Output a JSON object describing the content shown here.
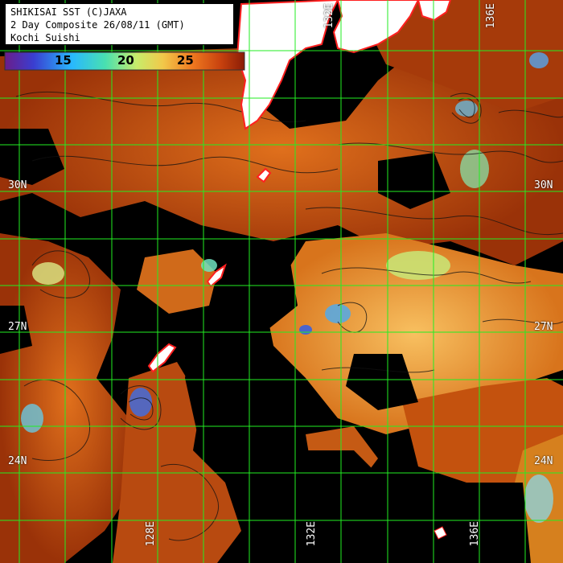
{
  "header": {
    "line1": "SHIKISAI SST (C)JAXA",
    "line2": "2 Day Composite 26/08/11 (GMT)",
    "line3": "Kochi Suishi"
  },
  "colorbar": {
    "ticks": [
      "15",
      "20",
      "25"
    ],
    "tick_values": [
      15,
      20,
      25
    ],
    "range": [
      10,
      30
    ],
    "colors": [
      "#6b1d8a",
      "#2a4bd8",
      "#28c6ff",
      "#49e0b0",
      "#b7e86a",
      "#f2c84a",
      "#f07a20",
      "#c8420e",
      "#8a1c06"
    ]
  },
  "lat_labels": [
    {
      "text": "30N",
      "side": "left"
    },
    {
      "text": "30N",
      "side": "right"
    },
    {
      "text": "27N",
      "side": "left"
    },
    {
      "text": "27N",
      "side": "right"
    },
    {
      "text": "24N",
      "side": "left"
    },
    {
      "text": "24N",
      "side": "right"
    }
  ],
  "lon_labels": [
    {
      "text": "128E",
      "edge": "bottom"
    },
    {
      "text": "132E",
      "edge": "bottom"
    },
    {
      "text": "136E",
      "edge": "bottom"
    },
    {
      "text": "132E",
      "edge": "top"
    },
    {
      "text": "136E",
      "edge": "top"
    }
  ],
  "colors": {
    "land": "#ffffff",
    "coast": "#ff2020",
    "grid": "#22ee22",
    "ocean_no_data": "#000000",
    "sst_warm": "#c8540f",
    "sst_hot": "#8a2a06",
    "sst_mid": "#f0a040",
    "sst_cool": "#a8e878"
  }
}
